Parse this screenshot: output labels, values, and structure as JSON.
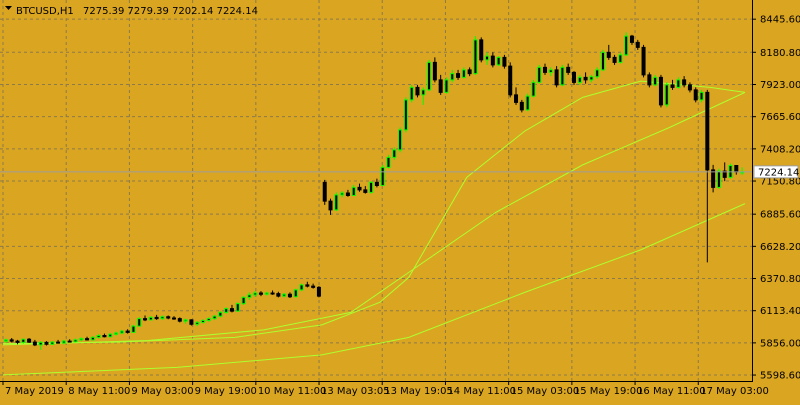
{
  "chart_data": {
    "type": "candlestick",
    "header": {
      "symbol": "BTCUSD,H1",
      "ohlc": "7275.39 7279.39 7202.14 7224.14"
    },
    "current_price": 7224.14,
    "current_price_label": "7224.14",
    "y_ticks": [
      8445.6,
      8180.8,
      7923.0,
      7665.6,
      7408.2,
      7150.8,
      6885.6,
      6628.2,
      6370.8,
      6113.4,
      5856.0,
      5598.6
    ],
    "y_tick_labels": [
      "8445.60",
      "8180.80",
      "7923.00",
      "7665.60",
      "7408.20",
      "7150.80",
      "6885.60",
      "6628.20",
      "6370.80",
      "6113.40",
      "5856.00",
      "5598.60"
    ],
    "ylim": [
      5575,
      8535
    ],
    "x_labels": [
      "7 May 2019",
      "8 May 11:00",
      "9 May 03:00",
      "9 May 19:00",
      "10 May 11:00",
      "13 May 03:05",
      "13 May 19:05",
      "14 May 11:00",
      "15 May 03:00",
      "15 May 19:00",
      "16 May 11:00",
      "17 May 03:00"
    ],
    "bars": 128,
    "grid": true,
    "colors": {
      "background": "#DAA520",
      "grid": "#8C7A4A",
      "bull_body": "#000000",
      "bear_body": "#000000",
      "wick": "#000000",
      "up_candle": "#00FF00",
      "ma": "#ADFF2F",
      "price_line": "#999999"
    },
    "ohlc": [
      [
        5870,
        5890,
        5855,
        5880
      ],
      [
        5880,
        5895,
        5860,
        5870
      ],
      [
        5870,
        5880,
        5845,
        5860
      ],
      [
        5860,
        5890,
        5850,
        5885
      ],
      [
        5885,
        5895,
        5855,
        5862
      ],
      [
        5862,
        5880,
        5830,
        5840
      ],
      [
        5840,
        5870,
        5800,
        5860
      ],
      [
        5860,
        5870,
        5835,
        5845
      ],
      [
        5845,
        5870,
        5840,
        5862
      ],
      [
        5862,
        5880,
        5850,
        5855
      ],
      [
        5855,
        5880,
        5845,
        5870
      ],
      [
        5870,
        5885,
        5860,
        5865
      ],
      [
        5865,
        5890,
        5860,
        5880
      ],
      [
        5880,
        5900,
        5870,
        5890
      ],
      [
        5890,
        5905,
        5875,
        5880
      ],
      [
        5880,
        5910,
        5875,
        5900
      ],
      [
        5900,
        5925,
        5890,
        5915
      ],
      [
        5915,
        5930,
        5900,
        5905
      ],
      [
        5905,
        5935,
        5900,
        5925
      ],
      [
        5925,
        5945,
        5915,
        5935
      ],
      [
        5935,
        5960,
        5925,
        5950
      ],
      [
        5950,
        5965,
        5930,
        5940
      ],
      [
        5940,
        6000,
        5935,
        5990
      ],
      [
        5990,
        6060,
        5985,
        6050
      ],
      [
        6050,
        6075,
        6030,
        6040
      ],
      [
        6040,
        6070,
        6035,
        6060
      ],
      [
        6060,
        6080,
        6040,
        6050
      ],
      [
        6050,
        6075,
        6040,
        6065
      ],
      [
        6065,
        6075,
        6045,
        6055
      ],
      [
        6055,
        6070,
        6040,
        6050
      ],
      [
        6050,
        6060,
        6020,
        6030
      ],
      [
        6030,
        6050,
        6010,
        6040
      ],
      [
        6040,
        6045,
        5995,
        6005
      ],
      [
        6005,
        6030,
        5990,
        6020
      ],
      [
        6020,
        6045,
        6010,
        6035
      ],
      [
        6035,
        6060,
        6025,
        6050
      ],
      [
        6050,
        6080,
        6040,
        6070
      ],
      [
        6070,
        6110,
        6060,
        6100
      ],
      [
        6100,
        6140,
        6090,
        6130
      ],
      [
        6130,
        6160,
        6100,
        6110
      ],
      [
        6110,
        6180,
        6105,
        6170
      ],
      [
        6170,
        6230,
        6160,
        6220
      ],
      [
        6220,
        6260,
        6200,
        6240
      ],
      [
        6240,
        6270,
        6225,
        6255
      ],
      [
        6255,
        6270,
        6230,
        6245
      ],
      [
        6245,
        6265,
        6235,
        6255
      ],
      [
        6255,
        6275,
        6240,
        6250
      ],
      [
        6250,
        6265,
        6220,
        6230
      ],
      [
        6230,
        6255,
        6220,
        6245
      ],
      [
        6245,
        6260,
        6215,
        6225
      ],
      [
        6225,
        6290,
        6220,
        6280
      ],
      [
        6280,
        6330,
        6270,
        6320
      ],
      [
        6320,
        6345,
        6300,
        6310
      ],
      [
        6310,
        6330,
        6290,
        6300
      ],
      [
        6300,
        6310,
        6220,
        6230
      ],
      [
        7140,
        7160,
        6960,
        6990
      ],
      [
        6990,
        7010,
        6880,
        6920
      ],
      [
        6920,
        7060,
        6910,
        7040
      ],
      [
        7040,
        7070,
        7020,
        7055
      ],
      [
        7055,
        7080,
        7025,
        7035
      ],
      [
        7035,
        7120,
        7030,
        7100
      ],
      [
        7100,
        7130,
        7065,
        7080
      ],
      [
        7080,
        7110,
        7050,
        7060
      ],
      [
        7060,
        7150,
        7050,
        7140
      ],
      [
        7140,
        7170,
        7100,
        7115
      ],
      [
        7115,
        7280,
        7110,
        7260
      ],
      [
        7260,
        7360,
        7250,
        7340
      ],
      [
        7340,
        7420,
        7320,
        7400
      ],
      [
        7400,
        7580,
        7380,
        7560
      ],
      [
        7560,
        7820,
        7540,
        7800
      ],
      [
        7800,
        7920,
        7780,
        7900
      ],
      [
        7900,
        7920,
        7820,
        7840
      ],
      [
        7840,
        7900,
        7760,
        7880
      ],
      [
        7880,
        8120,
        7870,
        8100
      ],
      [
        8100,
        8140,
        7940,
        7960
      ],
      [
        7960,
        8000,
        7840,
        7860
      ],
      [
        7860,
        7980,
        7850,
        7960
      ],
      [
        7960,
        8040,
        7940,
        8010
      ],
      [
        8010,
        8040,
        7960,
        7980
      ],
      [
        7980,
        8060,
        7970,
        8040
      ],
      [
        8040,
        8060,
        7990,
        8010
      ],
      [
        8010,
        8310,
        8000,
        8280
      ],
      [
        8280,
        8300,
        8100,
        8120
      ],
      [
        8120,
        8180,
        8080,
        8150
      ],
      [
        8150,
        8180,
        8060,
        8080
      ],
      [
        8080,
        8150,
        8070,
        8140
      ],
      [
        8140,
        8160,
        8050,
        8070
      ],
      [
        8070,
        8100,
        7820,
        7840
      ],
      [
        7840,
        7900,
        7760,
        7780
      ],
      [
        7780,
        7800,
        7700,
        7720
      ],
      [
        7720,
        7850,
        7710,
        7830
      ],
      [
        7830,
        7960,
        7820,
        7940
      ],
      [
        7940,
        8080,
        7930,
        8060
      ],
      [
        8060,
        8090,
        8000,
        8020
      ],
      [
        8020,
        8060,
        7990,
        8040
      ],
      [
        8040,
        8070,
        7900,
        7920
      ],
      [
        7920,
        8080,
        7910,
        8060
      ],
      [
        8060,
        8090,
        8000,
        8020
      ],
      [
        8020,
        8030,
        7920,
        7940
      ],
      [
        7940,
        8000,
        7920,
        7980
      ],
      [
        7980,
        8020,
        7930,
        7960
      ],
      [
        7960,
        8000,
        7940,
        7985
      ],
      [
        7985,
        8060,
        7970,
        8040
      ],
      [
        8040,
        8200,
        8030,
        8180
      ],
      [
        8180,
        8240,
        8120,
        8140
      ],
      [
        8140,
        8160,
        8080,
        8100
      ],
      [
        8100,
        8180,
        8090,
        8160
      ],
      [
        8160,
        8340,
        8150,
        8310
      ],
      [
        8310,
        8320,
        8240,
        8260
      ],
      [
        8260,
        8280,
        8200,
        8220
      ],
      [
        8220,
        8240,
        7980,
        8000
      ],
      [
        8000,
        8020,
        7900,
        7920
      ],
      [
        7920,
        8000,
        7910,
        7980
      ],
      [
        7980,
        8000,
        7740,
        7760
      ],
      [
        7760,
        7940,
        7740,
        7920
      ],
      [
        7920,
        7960,
        7880,
        7900
      ],
      [
        7900,
        7980,
        7890,
        7960
      ],
      [
        7960,
        7990,
        7900,
        7920
      ],
      [
        7920,
        7940,
        7860,
        7880
      ],
      [
        7880,
        7900,
        7780,
        7800
      ],
      [
        7800,
        7880,
        7780,
        7860
      ],
      [
        7860,
        7880,
        6500,
        7240
      ],
      [
        7240,
        7280,
        7060,
        7100
      ],
      [
        7100,
        7250,
        7090,
        7230
      ],
      [
        7230,
        7300,
        7150,
        7180
      ],
      [
        7180,
        7290,
        7170,
        7275
      ],
      [
        7275,
        7279,
        7202,
        7224
      ],
      [
        7224,
        7260,
        7200,
        7224
      ]
    ],
    "ma_series": [
      {
        "name": "",
        "points": [
          [
            0,
            5850
          ],
          [
            20,
            5862
          ],
          [
            40,
            5900
          ],
          [
            55,
            6000
          ],
          [
            65,
            6180
          ],
          [
            70,
            6380
          ],
          [
            80,
            7180
          ],
          [
            90,
            7550
          ],
          [
            100,
            7820
          ],
          [
            110,
            7950
          ],
          [
            122,
            7900
          ],
          [
            128,
            7860
          ]
        ]
      },
      {
        "name": "",
        "points": [
          [
            0,
            5840
          ],
          [
            25,
            5875
          ],
          [
            45,
            5960
          ],
          [
            60,
            6100
          ],
          [
            70,
            6420
          ],
          [
            85,
            6900
          ],
          [
            100,
            7280
          ],
          [
            115,
            7580
          ],
          [
            128,
            7860
          ]
        ]
      },
      {
        "name": "",
        "points": [
          [
            0,
            5600
          ],
          [
            30,
            5660
          ],
          [
            55,
            5760
          ],
          [
            70,
            5900
          ],
          [
            90,
            6260
          ],
          [
            110,
            6600
          ],
          [
            128,
            6970
          ]
        ]
      }
    ]
  }
}
